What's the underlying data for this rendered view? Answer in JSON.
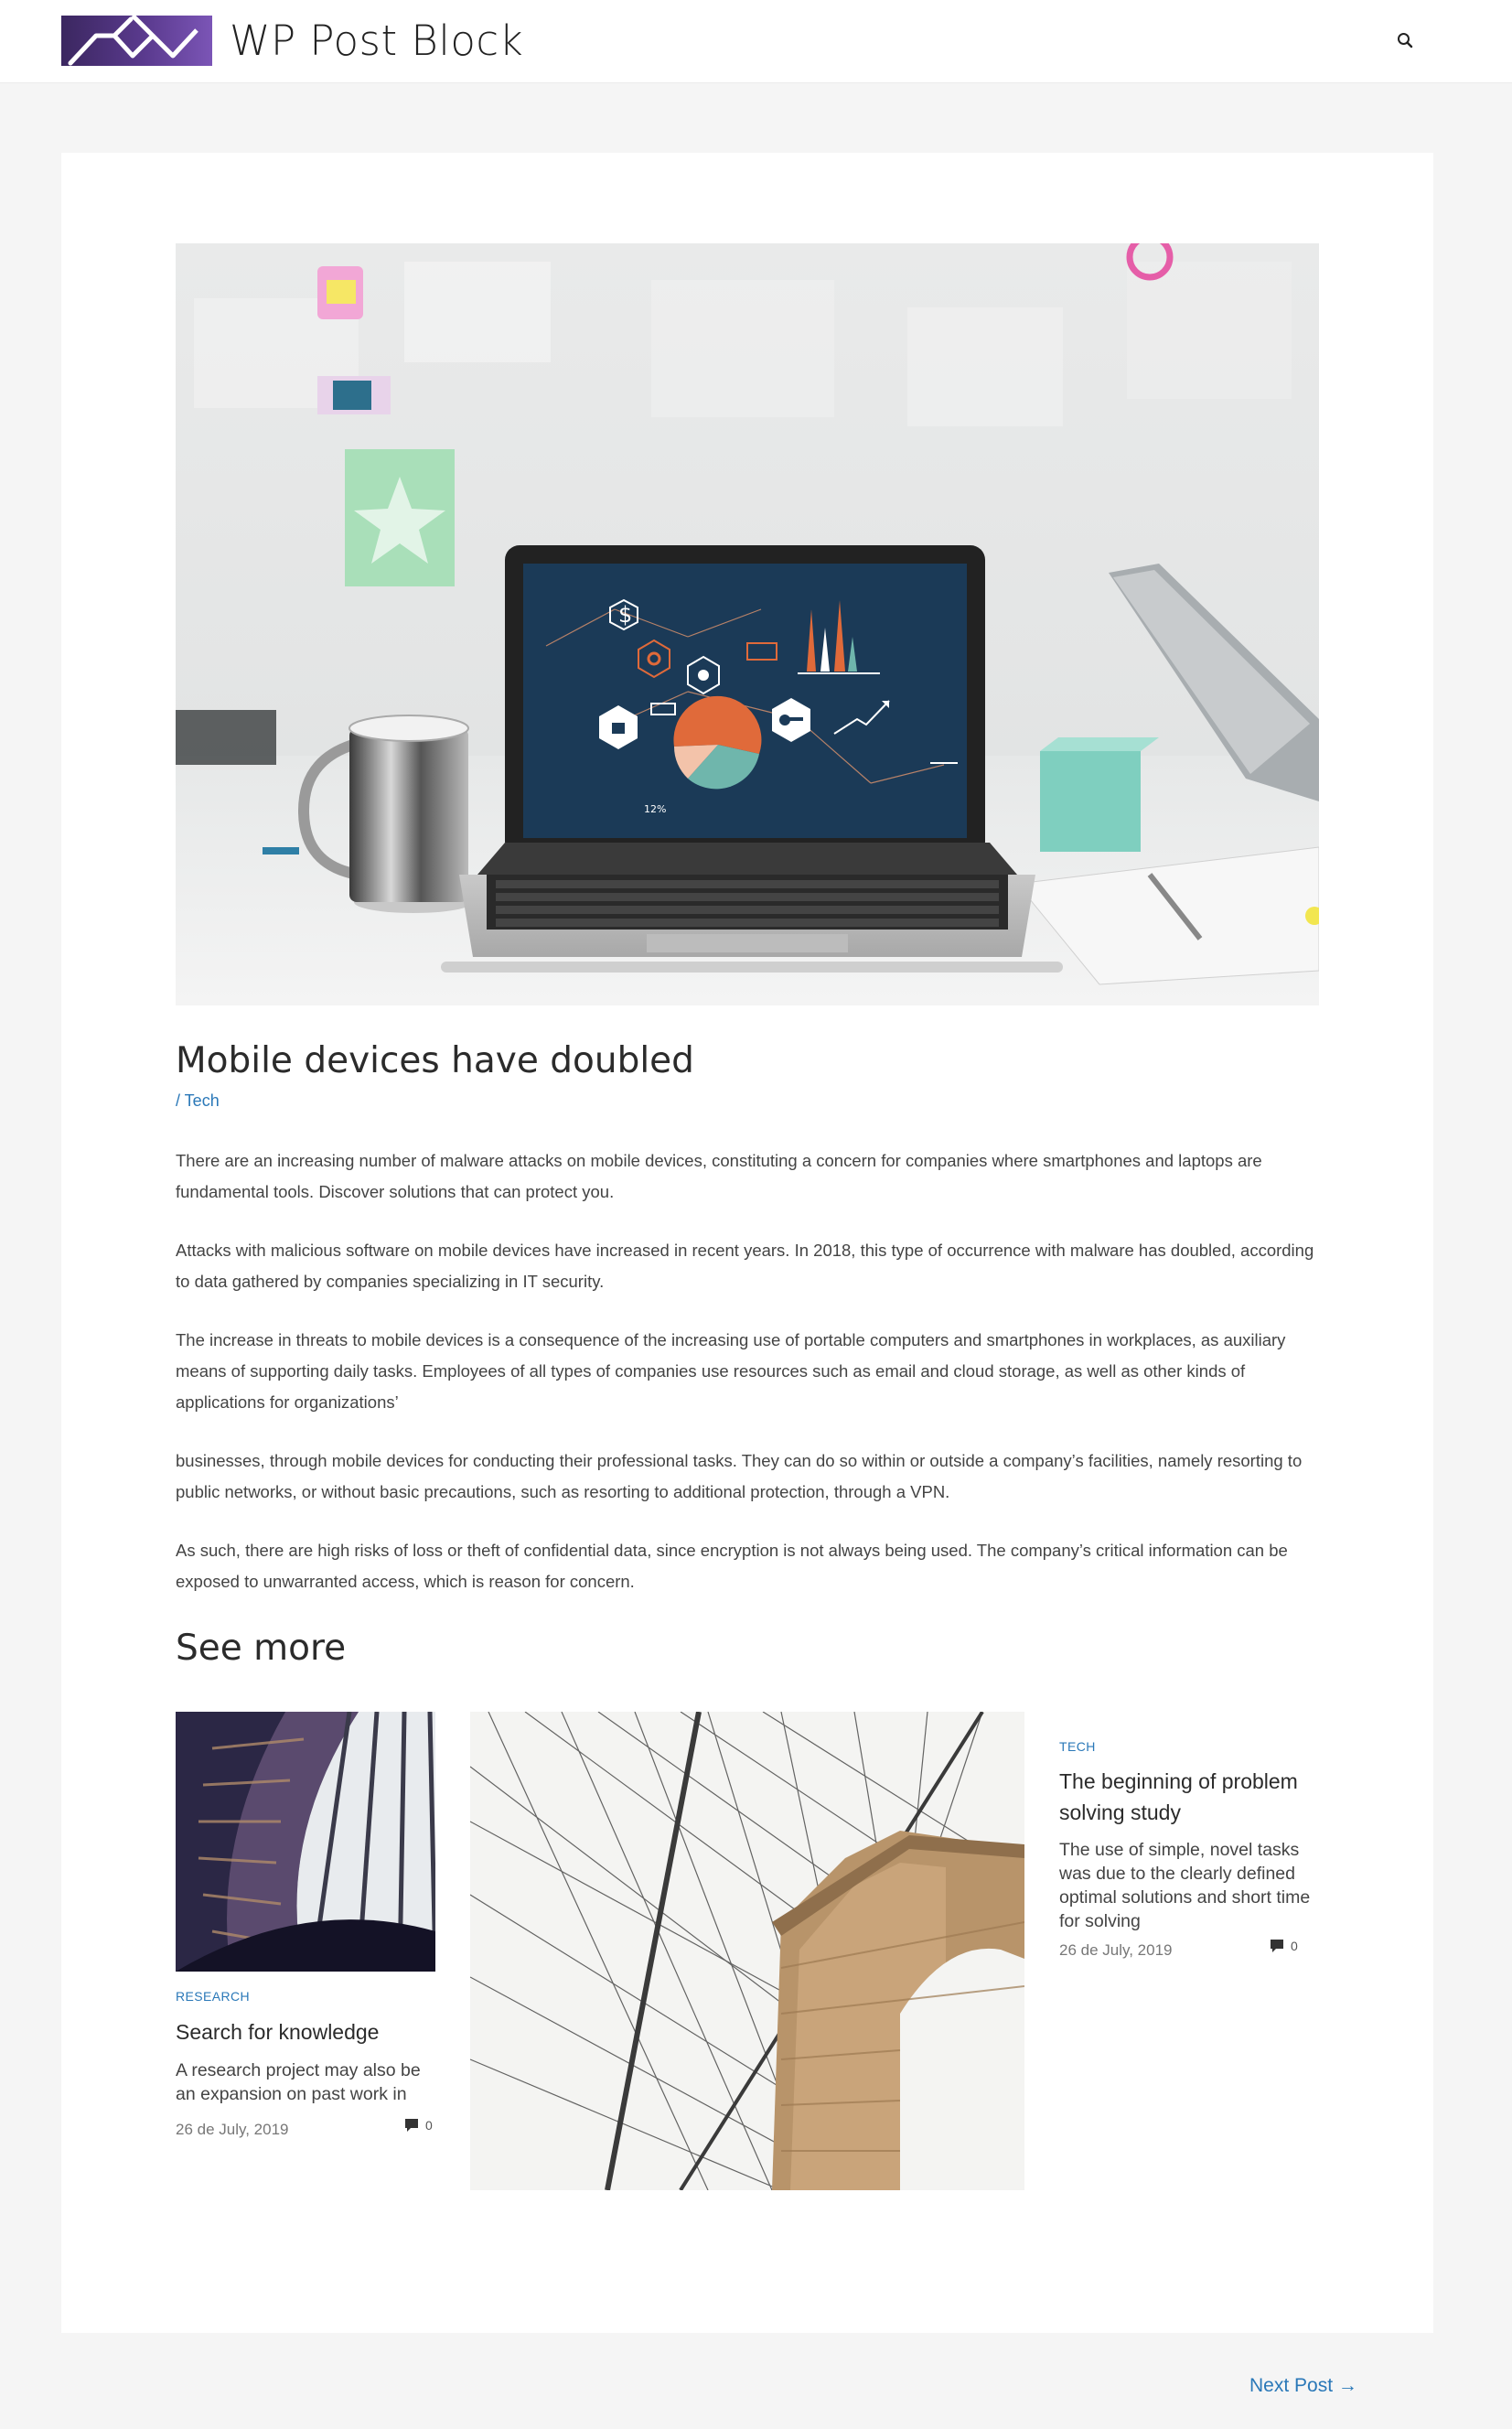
{
  "site": {
    "title": "WP Post Block"
  },
  "post": {
    "title": "Mobile devices have doubled",
    "category": "/ Tech",
    "paragraphs": [
      "There are an increasing number of malware attacks on mobile devices, constituting a concern for companies where smartphones and laptops are fundamental tools. Discover solutions that can protect you.",
      "Attacks with malicious software on mobile devices have increased in recent years. In 2018, this type of occurrence with malware has doubled, according to data gathered by companies specializing in IT security.",
      "The increase in threats to mobile devices is a consequence of the increasing use of portable computers and smartphones in workplaces, as auxiliary means of supporting daily tasks. Employees of all types of companies use resources such as email and cloud storage, as well as other kinds of applications for organizations’",
      "businesses, through mobile devices for conducting their professional tasks. They can do so within or outside a company’s facilities, namely resorting to public networks, or without basic precautions, such as resorting to additional protection, through a VPN.",
      "As such, there are high risks of loss or theft of confidential data, since encryption is not always being used. The company’s critical information can be exposed to unwarranted access, which is reason for concern."
    ]
  },
  "see_more": {
    "heading": "See more",
    "items": [
      {
        "category": "RESEARCH",
        "title": "Search for knowledge",
        "excerpt": "A research project may also be an expansion on past work in",
        "date": "26 de July, 2019",
        "comments": "0"
      },
      {
        "category": "TECH",
        "title": "The beginning of problem solving study",
        "excerpt": "The use of simple, novel tasks was due to the clearly defined optimal solutions and short time for solving",
        "date": "26 de July, 2019",
        "comments": "0"
      }
    ]
  },
  "navigation": {
    "next_post": "Next Post →"
  },
  "colors": {
    "accent": "#2a78b8",
    "logo_start": "#3b2760",
    "logo_end": "#7b55b6",
    "background": "#f5f5f5"
  },
  "icons": {
    "search": "search-icon",
    "comment": "comment-icon"
  }
}
